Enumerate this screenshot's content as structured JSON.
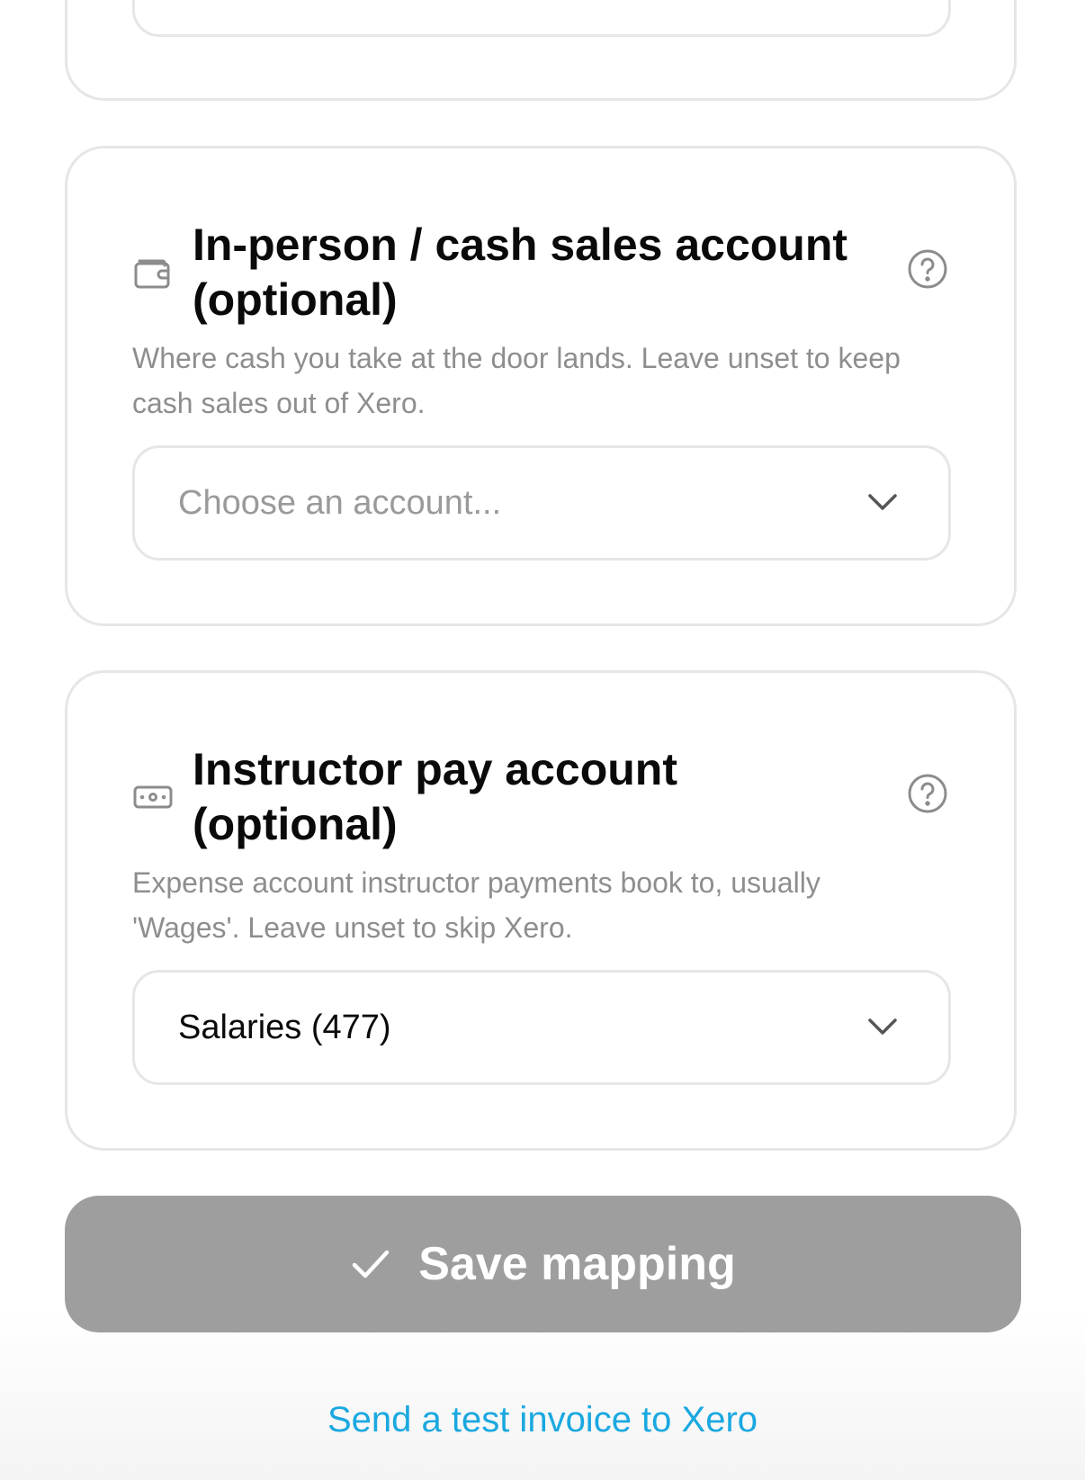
{
  "cash_account": {
    "title": "In-person / cash sales account (optional)",
    "description": "Where cash you take at the door lands. Leave unset to keep cash sales out of Xero.",
    "placeholder": "Choose an account...",
    "icon": "wallet-icon"
  },
  "instructor_account": {
    "title": "Instructor pay account (optional)",
    "description": "Expense account instructor payments book to, usually 'Wages'. Leave unset to skip Xero.",
    "selected_value": "Salaries (477)",
    "icon": "banknote-icon"
  },
  "actions": {
    "save_label": "Save mapping",
    "test_link_label": "Send a test invoice to Xero"
  },
  "colors": {
    "save_button_disabled": "#9e9e9e",
    "link": "#1aa8e0",
    "muted_text": "#8e8e8e",
    "border": "#e6e6e6"
  }
}
